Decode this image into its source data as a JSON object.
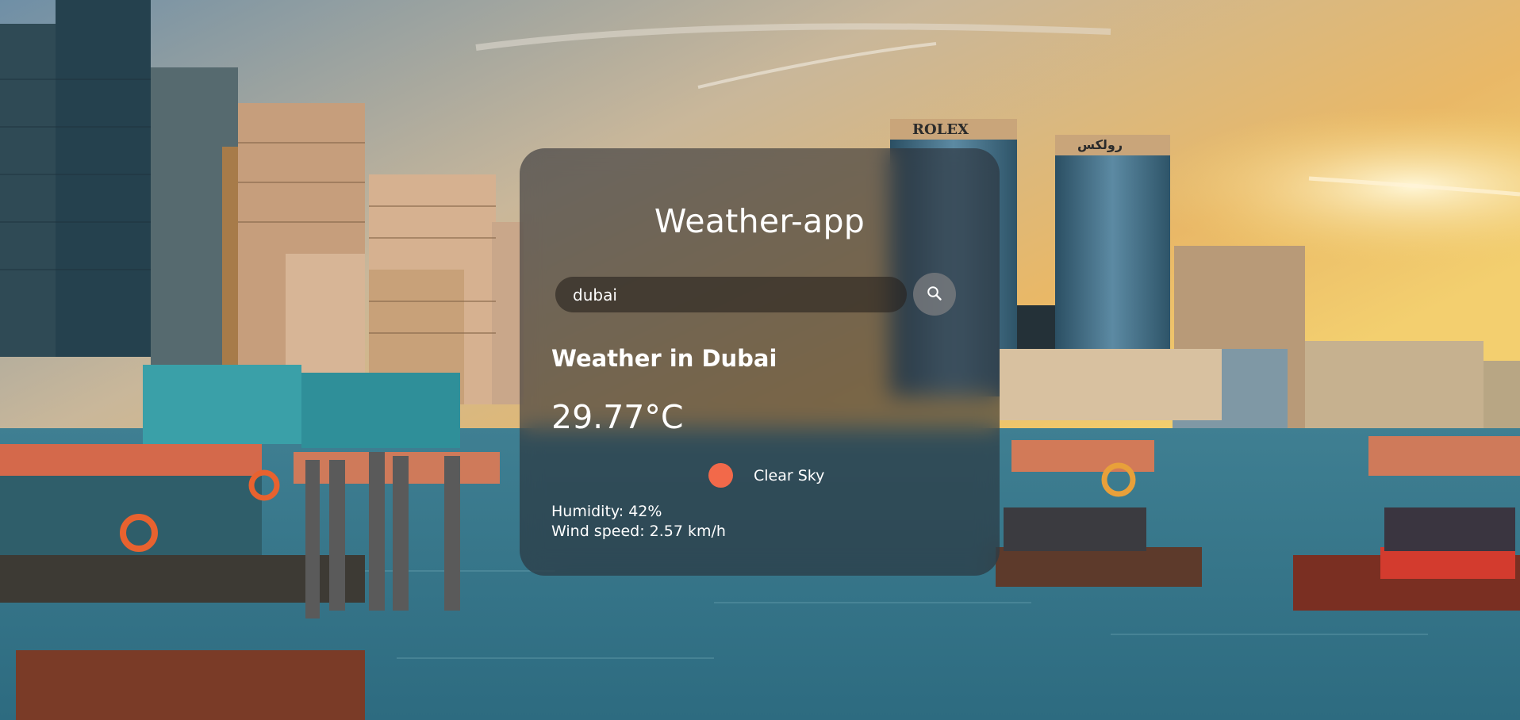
{
  "app": {
    "title": "Weather-app"
  },
  "search": {
    "value": "dubai",
    "placeholder": "",
    "button_icon": "search-icon"
  },
  "weather": {
    "city_label": "Weather in Dubai",
    "temperature": "29.77°C",
    "icon": "clear-sky-sun-icon",
    "icon_color": "#f2694a",
    "description": "Clear Sky",
    "humidity": "Humidity: 42%",
    "wind": "Wind speed: 2.57 km/h"
  },
  "background": {
    "scene": "dubai-creek-skyline-photo",
    "building_signs": [
      "ROLEX",
      "رولكس"
    ]
  }
}
